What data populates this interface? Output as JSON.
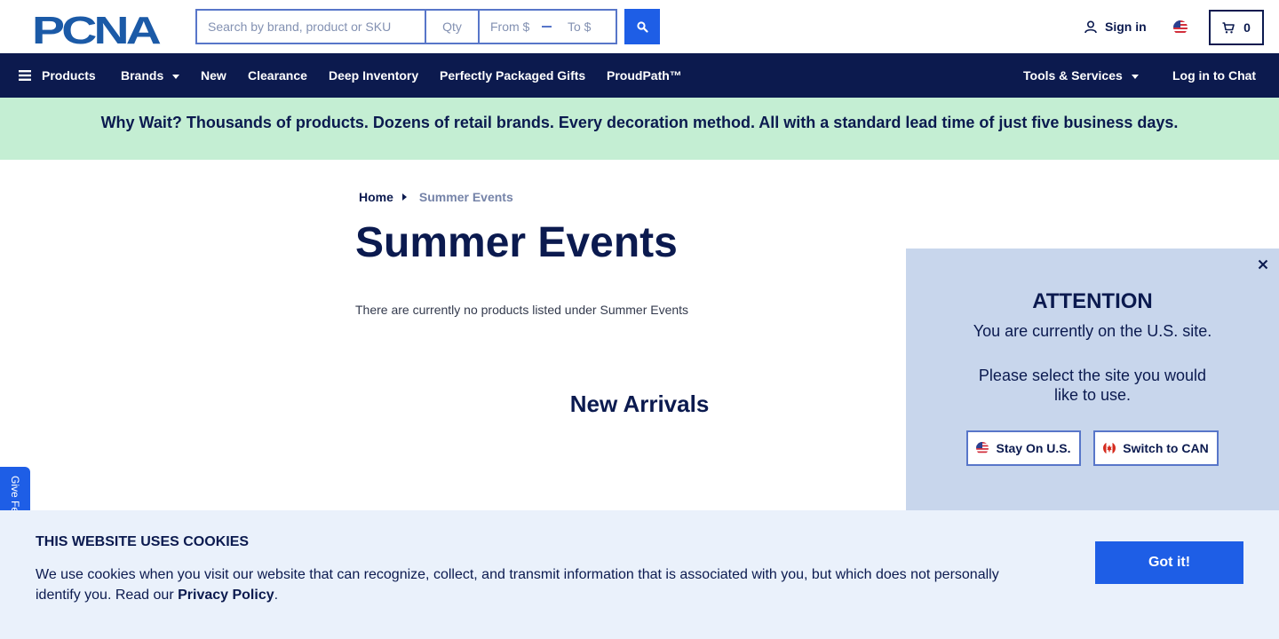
{
  "header": {
    "logo_text": "PCNA",
    "search": {
      "placeholder": "Search by brand, product or SKU",
      "qty_placeholder": "Qty",
      "from_placeholder": "From $",
      "to_placeholder": "To $"
    },
    "sign_in_label": "Sign in",
    "cart_count": "0"
  },
  "nav": {
    "items": [
      {
        "label": "Products"
      },
      {
        "label": "Brands"
      },
      {
        "label": "New"
      },
      {
        "label": "Clearance"
      },
      {
        "label": "Deep Inventory"
      },
      {
        "label": "Perfectly Packaged Gifts"
      },
      {
        "label": "ProudPath™"
      }
    ],
    "tools_label": "Tools & Services",
    "chat_label": "Log in to Chat"
  },
  "banner": {
    "text": "Why Wait? Thousands of products. Dozens of retail brands. Every decoration method. All with a standard lead time of just five business days."
  },
  "breadcrumb": {
    "home": "Home",
    "current": "Summer Events"
  },
  "main": {
    "title": "Summer Events",
    "empty_message": "There are currently no products listed under Summer Events",
    "new_arrivals": "New Arrivals"
  },
  "feedback": {
    "label": "Give Fe"
  },
  "attention": {
    "heading": "ATTENTION",
    "line1": "You are currently on the U.S. site.",
    "line2": "Please select the site you would like to use.",
    "stay_label": "Stay On U.S.",
    "switch_label": "Switch to CAN"
  },
  "cookie": {
    "title": "THIS WEBSITE USES COOKIES",
    "text": "We use cookies when you visit our website that can recognize, collect, and transmit information that is associated with you, but which does not personally identify you. Read our ",
    "link": "Privacy Policy",
    "end": ".",
    "button": "Got it!"
  },
  "colors": {
    "navy": "#0c1a4e",
    "accent_blue": "#1e5ee6",
    "banner_green": "#c4eed3",
    "modal_bg": "#c8d6ec",
    "cookie_bg": "#eaf1fb"
  }
}
